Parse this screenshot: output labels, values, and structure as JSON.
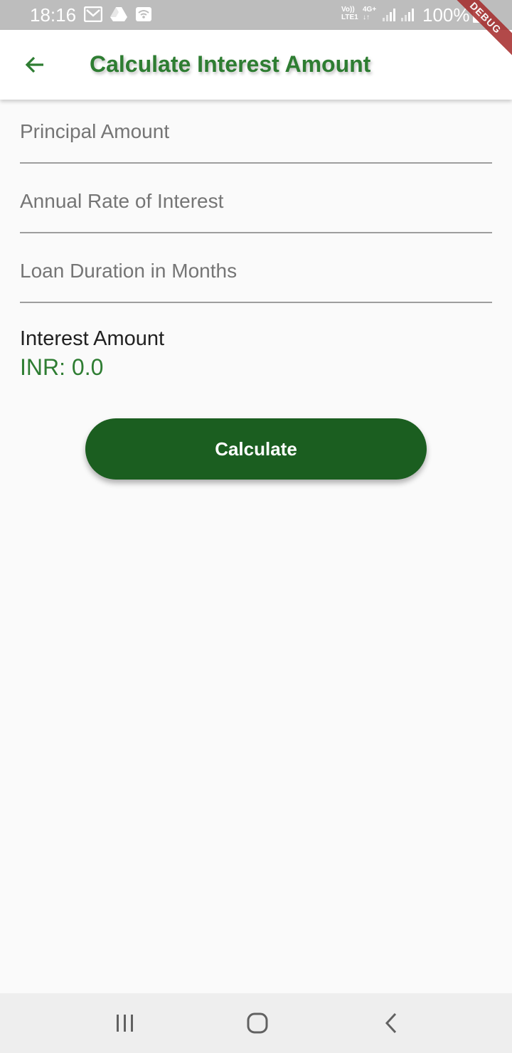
{
  "status_bar": {
    "time": "18:16",
    "network_line1": "Vo))",
    "network_line2": "LTE1",
    "data_type": "4G+",
    "battery_text": "100%",
    "icons": [
      "gmail-icon",
      "drive-icon",
      "wifi-calling-icon",
      "signal-icon",
      "battery-icon"
    ]
  },
  "debug_banner": "DEBUG",
  "app_bar": {
    "title": "Calculate Interest Amount",
    "back_icon": "arrow-back-icon"
  },
  "form": {
    "principal_placeholder": "Principal Amount",
    "principal_value": "",
    "rate_placeholder": "Annual Rate of Interest",
    "rate_value": "",
    "duration_placeholder": "Loan Duration in Months",
    "duration_value": ""
  },
  "result": {
    "label": "Interest Amount",
    "value": "INR: 0.0"
  },
  "actions": {
    "calculate_label": "Calculate"
  },
  "nav_bar": {
    "icons": [
      "recent-apps-icon",
      "home-icon",
      "back-icon"
    ]
  },
  "colors": {
    "primary": "#2e7d32",
    "button": "#1b5e20",
    "status_bar": "#bdbdbd",
    "background": "#fafafa",
    "debug_ribbon": "#a52a2a"
  }
}
